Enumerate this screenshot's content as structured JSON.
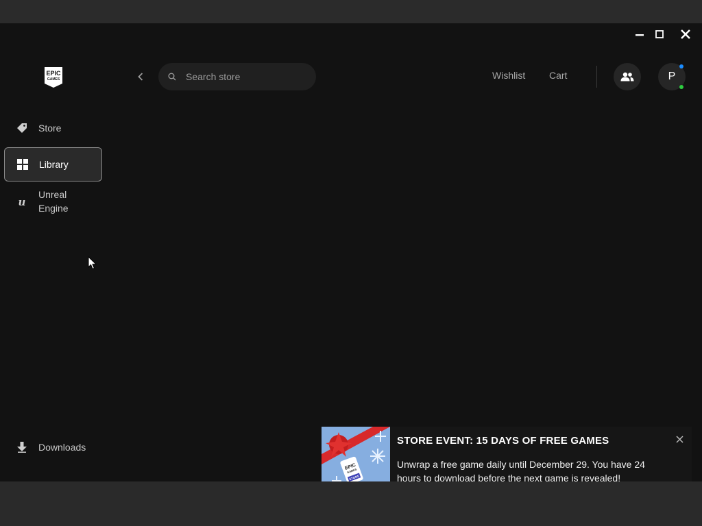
{
  "window": {
    "minimize_icon": "minimize-icon",
    "maximize_icon": "maximize-icon",
    "close_icon": "close-icon"
  },
  "logo": {
    "text_line1": "EPIC",
    "text_line2": "GAMES"
  },
  "sidebar": {
    "items": [
      {
        "label": "Store",
        "icon": "tag-icon"
      },
      {
        "label": "Library",
        "icon": "grid-icon",
        "active": true
      },
      {
        "label": "Unreal Engine",
        "icon": "unreal-icon"
      }
    ],
    "downloads": {
      "label": "Downloads",
      "icon": "download-icon"
    }
  },
  "header": {
    "search": {
      "placeholder": "Search store",
      "value": ""
    },
    "wishlist_label": "Wishlist",
    "cart_label": "Cart",
    "avatar_initial": "P"
  },
  "toast": {
    "title": "STORE EVENT: 15 DAYS OF FREE GAMES",
    "body": "Unwrap a free game daily until December 29. You have 24 hours to download before the next game is revealed!",
    "thumb_logo_line1": "EPIC",
    "thumb_logo_line2": "GAMES",
    "thumb_logo_line3": "STORE"
  },
  "colors": {
    "background": "#121212",
    "accent_blue": "#1a8cff",
    "status_green": "#2ecc40",
    "active_border": "#8a8a8a"
  }
}
